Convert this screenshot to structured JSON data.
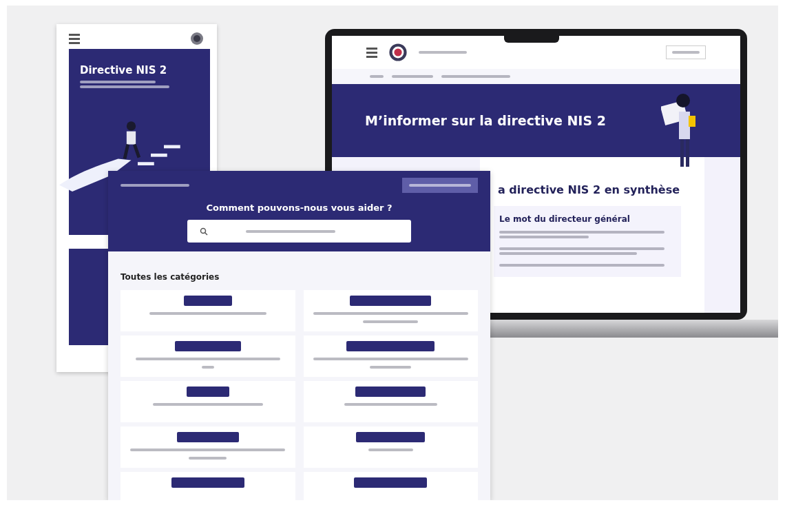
{
  "brochure": {
    "title": "Directive NIS 2"
  },
  "laptop_page": {
    "hero_title": "M’informer sur la directive NIS 2",
    "section_title": "a directive NIS 2 en synthèse",
    "card_title": "Le mot du directeur général"
  },
  "help_page": {
    "heading": "Comment pouvons-nous vous aider ?",
    "section_title": "Toutes les catégories"
  }
}
